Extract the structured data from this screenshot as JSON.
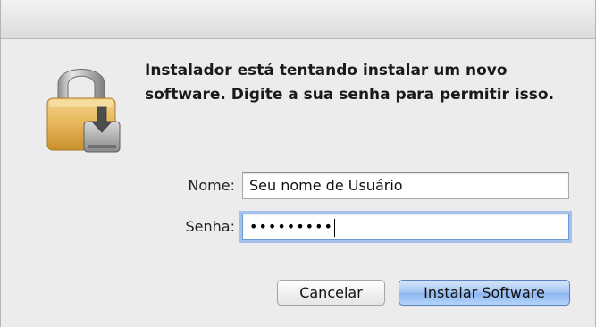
{
  "dialog": {
    "message": "Instalador está tentando instalar um novo software. Digite a sua senha para permitir isso."
  },
  "form": {
    "name_label": "Nome:",
    "name_value": "Seu nome de Usuário",
    "password_label": "Senha:",
    "password_mask": "•••••••••"
  },
  "buttons": {
    "cancel_label": "Cancelar",
    "install_label": "Instalar Software"
  },
  "icons": {
    "lock": "lock-installer-icon"
  },
  "colors": {
    "focus_ring": "#689eea",
    "default_button": "#8db7ef"
  }
}
